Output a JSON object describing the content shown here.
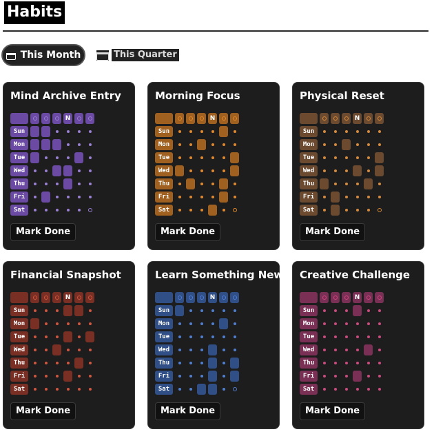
{
  "page": {
    "title": "Habits"
  },
  "tabs": {
    "active_label": "This Month",
    "inactive_label": "This Quarter"
  },
  "colors": {
    "card_bg": "#1d1d1d"
  },
  "habits": [
    {
      "name": "Mind Archive Entry",
      "accent": "#6a4aa3",
      "dot": "#9a7fd4",
      "button": "Mark Done",
      "header": [
        "",
        "",
        "",
        "N",
        "",
        ""
      ],
      "days": [
        "Sun",
        "Mon",
        "Tue",
        "Wed",
        "Thu",
        "Fri",
        "Sat"
      ],
      "pattern": [
        [
          1,
          1,
          0,
          0,
          0,
          0
        ],
        [
          1,
          1,
          1,
          0,
          0,
          0
        ],
        [
          1,
          0,
          0,
          0,
          1,
          0
        ],
        [
          0,
          0,
          1,
          1,
          0,
          0
        ],
        [
          0,
          0,
          0,
          1,
          0,
          0
        ],
        [
          0,
          1,
          0,
          0,
          0,
          0
        ],
        [
          0,
          0,
          0,
          0,
          0,
          2
        ]
      ]
    },
    {
      "name": "Morning Focus",
      "accent": "#a0601f",
      "dot": "#e08a2c",
      "button": "Mark Done",
      "header": [
        "",
        "",
        "",
        "N",
        "",
        ""
      ],
      "days": [
        "Sun",
        "Mon",
        "Tue",
        "Wed",
        "Thu",
        "Fri",
        "Sat"
      ],
      "pattern": [
        [
          0,
          0,
          0,
          0,
          1,
          0
        ],
        [
          0,
          0,
          1,
          0,
          0,
          0
        ],
        [
          0,
          0,
          0,
          0,
          0,
          1
        ],
        [
          1,
          0,
          0,
          0,
          0,
          1
        ],
        [
          0,
          1,
          0,
          0,
          1,
          0
        ],
        [
          0,
          0,
          0,
          0,
          1,
          0
        ],
        [
          0,
          0,
          0,
          1,
          0,
          2
        ]
      ]
    },
    {
      "name": "Physical Reset",
      "accent": "#6b4a30",
      "dot": "#d88a3a",
      "button": "Mark Done",
      "header": [
        "",
        "",
        "",
        "N",
        "",
        ""
      ],
      "days": [
        "Sun",
        "Mon",
        "Tue",
        "Wed",
        "Thu",
        "Fri",
        "Sat"
      ],
      "pattern": [
        [
          0,
          0,
          0,
          0,
          0,
          0
        ],
        [
          0,
          0,
          1,
          0,
          0,
          0
        ],
        [
          0,
          0,
          0,
          0,
          0,
          1
        ],
        [
          0,
          0,
          0,
          1,
          0,
          1
        ],
        [
          1,
          0,
          0,
          0,
          1,
          0
        ],
        [
          0,
          1,
          0,
          0,
          0,
          0
        ],
        [
          0,
          1,
          0,
          0,
          0,
          2
        ]
      ]
    },
    {
      "name": "Financial Snapshot",
      "accent": "#7a2f25",
      "dot": "#d2553f",
      "button": "Mark Done",
      "header": [
        "",
        "",
        "",
        "N",
        "",
        ""
      ],
      "days": [
        "Sun",
        "Mon",
        "Tue",
        "Wed",
        "Thu",
        "Fri",
        "Sat"
      ],
      "pattern": [
        [
          0,
          0,
          0,
          1,
          1,
          0
        ],
        [
          1,
          0,
          0,
          0,
          0,
          0
        ],
        [
          0,
          0,
          0,
          1,
          0,
          1
        ],
        [
          0,
          0,
          1,
          0,
          0,
          0
        ],
        [
          0,
          0,
          0,
          0,
          1,
          0
        ],
        [
          0,
          0,
          0,
          1,
          0,
          0
        ],
        [
          0,
          0,
          0,
          0,
          0,
          0
        ]
      ]
    },
    {
      "name": "Learn Something New",
      "accent": "#2f4f86",
      "dot": "#4f7fd0",
      "button": "Mark Done",
      "header": [
        "",
        "",
        "",
        "N",
        "",
        ""
      ],
      "days": [
        "Sun",
        "Mon",
        "Tue",
        "Wed",
        "Thu",
        "Fri",
        "Sat"
      ],
      "pattern": [
        [
          1,
          0,
          0,
          0,
          0,
          0
        ],
        [
          0,
          0,
          0,
          0,
          1,
          0
        ],
        [
          0,
          0,
          0,
          0,
          0,
          0
        ],
        [
          0,
          0,
          0,
          1,
          0,
          0
        ],
        [
          0,
          0,
          0,
          1,
          0,
          1
        ],
        [
          0,
          0,
          0,
          1,
          0,
          1
        ],
        [
          0,
          0,
          1,
          1,
          0,
          2
        ]
      ]
    },
    {
      "name": "Creative Challenge",
      "accent": "#7a2f55",
      "dot": "#d1477f",
      "button": "Mark Done",
      "header": [
        "",
        "",
        "",
        "N",
        "",
        ""
      ],
      "days": [
        "Sun",
        "Mon",
        "Tue",
        "Wed",
        "Thu",
        "Fri",
        "Sat"
      ],
      "pattern": [
        [
          0,
          0,
          0,
          1,
          0,
          0
        ],
        [
          0,
          0,
          0,
          0,
          0,
          0
        ],
        [
          0,
          0,
          0,
          0,
          0,
          0
        ],
        [
          0,
          0,
          0,
          0,
          1,
          0
        ],
        [
          0,
          0,
          0,
          0,
          0,
          0
        ],
        [
          0,
          0,
          0,
          1,
          0,
          0
        ],
        [
          0,
          0,
          0,
          0,
          0,
          0
        ]
      ]
    }
  ]
}
